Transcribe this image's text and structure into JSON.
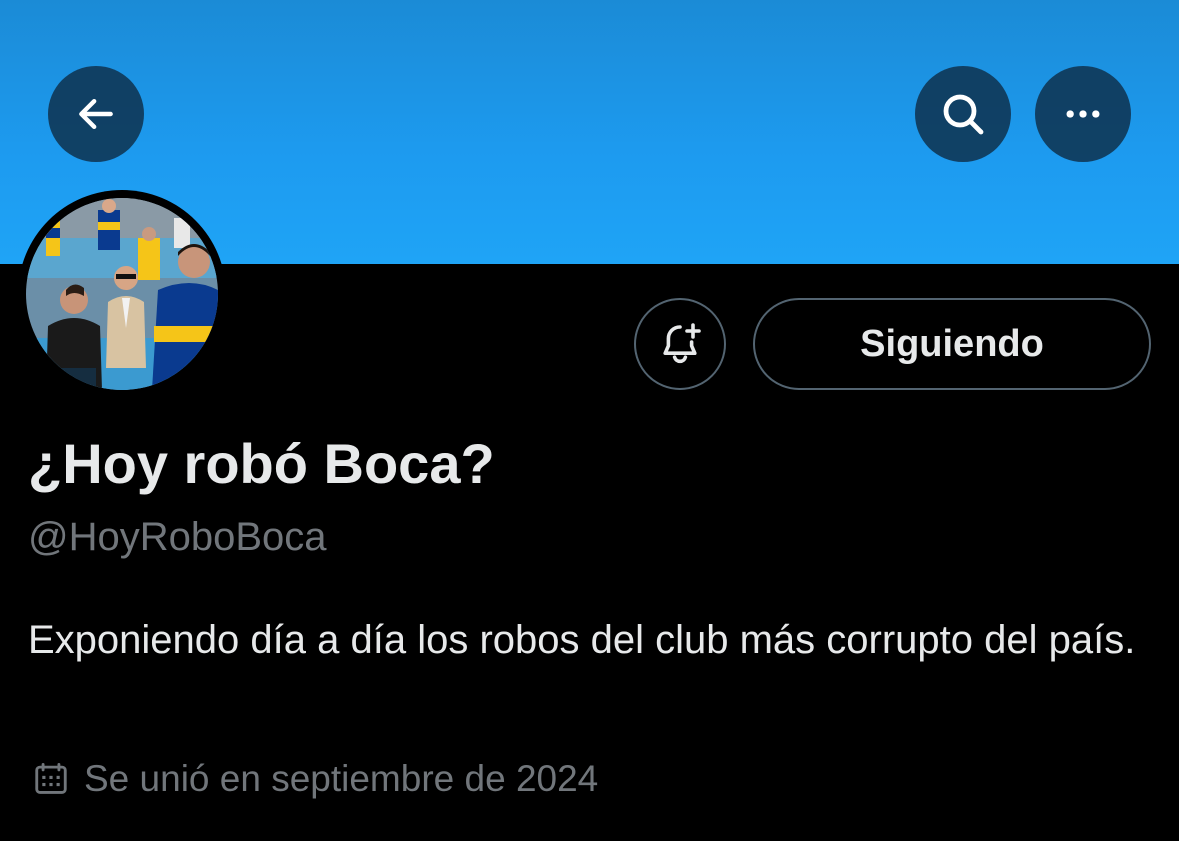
{
  "header": {
    "back_icon": "arrow-left-icon",
    "search_icon": "search-icon",
    "more_icon": "more-horizontal-icon",
    "banner_color": "#1d9bf0"
  },
  "profile": {
    "display_name": "¿Hoy robó Boca?",
    "handle": "@HoyRoboBoca",
    "bio": "Exponiendo día a día los robos del club más corrupto del país.",
    "joined": "Se unió en septiembre de 2024",
    "joined_icon": "calendar-icon"
  },
  "actions": {
    "notify_icon": "bell-plus-icon",
    "follow_label": "Siguiendo"
  },
  "colors": {
    "background": "#000000",
    "primary_text": "#e7e9ea",
    "secondary_text": "#71767b",
    "border": "#536471",
    "boca_blue": "#0a3a8f",
    "boca_yellow": "#f5c518"
  }
}
